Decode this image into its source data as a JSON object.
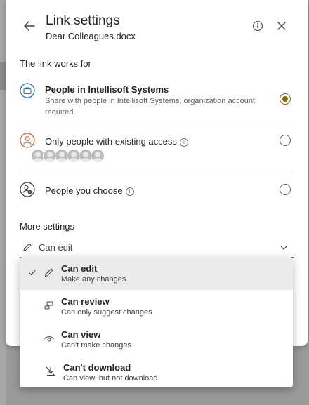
{
  "header": {
    "title": "Link settings",
    "subtitle": "Dear Colleagues.docx",
    "back_icon": "back-arrow-icon",
    "info_icon": "info-icon",
    "close_icon": "close-icon"
  },
  "link_works_for": {
    "label": "The link works for",
    "options": [
      {
        "title": "People in Intellisoft Systems",
        "description": "Share with people in Intellisoft Systems, organization account required.",
        "icon": "briefcase-icon",
        "selected": true
      },
      {
        "title": "Only people with existing access",
        "icon": "person-icon",
        "selected": false,
        "avatar_count": 5
      },
      {
        "title": "People you choose",
        "icon": "people-settings-icon",
        "selected": false
      }
    ]
  },
  "more_settings": {
    "label": "More settings",
    "permission_value": "Can edit"
  },
  "permission_menu": {
    "items": [
      {
        "title": "Can edit",
        "description": "Make any changes",
        "icon": "pencil-icon",
        "selected": true
      },
      {
        "title": "Can review",
        "description": "Can only suggest changes",
        "icon": "review-icon",
        "selected": false
      },
      {
        "title": "Can view",
        "description": "Can't make changes",
        "icon": "eye-icon",
        "selected": false
      },
      {
        "title": "Can't download",
        "description": "Can view, but not download",
        "icon": "no-download-icon",
        "selected": false
      }
    ]
  },
  "colors": {
    "accent": "#8a6a00",
    "text": "#242424",
    "secondary_text": "#616161"
  }
}
